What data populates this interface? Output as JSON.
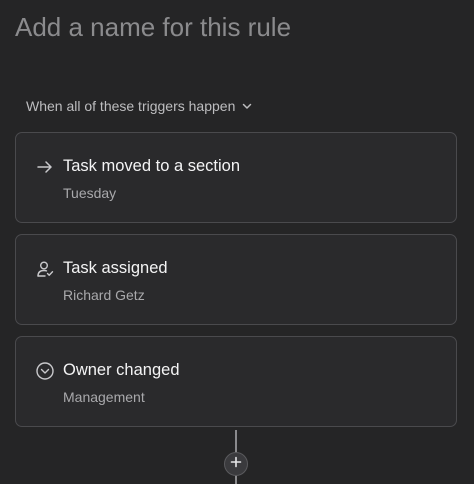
{
  "rule": {
    "name_placeholder": "Add a name for this rule"
  },
  "trigger_mode": {
    "label": "When all of these triggers happen",
    "icon": "chevron-down-icon"
  },
  "triggers": [
    {
      "title": "Task moved to a section",
      "detail": "Tuesday",
      "icon": "arrow-right-icon"
    },
    {
      "title": "Task assigned",
      "detail": "Richard Getz",
      "icon": "user-check-icon"
    },
    {
      "title": "Owner changed",
      "detail": "Management",
      "icon": "chevron-circle-icon"
    }
  ],
  "add_trigger": {
    "icon": "plus-icon"
  },
  "colors": {
    "background": "#252526",
    "card": "#2a2a2c",
    "card_border": "#4a4a4d",
    "text_primary": "#f4f4f5",
    "text_secondary": "#a9a9ac",
    "placeholder": "#8b8b8d"
  }
}
